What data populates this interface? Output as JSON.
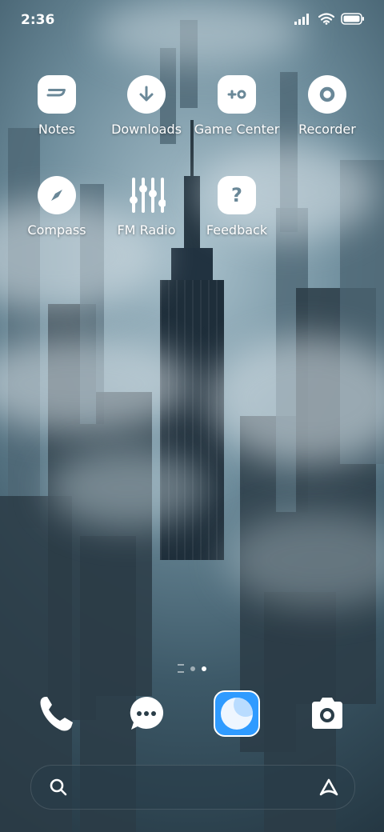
{
  "status_bar": {
    "time": "2:36"
  },
  "home_apps": [
    {
      "label": "Notes",
      "icon": "notes-icon"
    },
    {
      "label": "Downloads",
      "icon": "download-icon"
    },
    {
      "label": "Game Center",
      "icon": "gamepad-icon"
    },
    {
      "label": "Recorder",
      "icon": "record-icon"
    },
    {
      "label": "Compass",
      "icon": "compass-icon"
    },
    {
      "label": "FM Radio",
      "icon": "equalizer-icon"
    },
    {
      "label": "Feedback",
      "icon": "question-icon"
    }
  ],
  "page_indicator": {
    "pages": 2,
    "current": 2
  },
  "dock": [
    {
      "icon": "phone-icon"
    },
    {
      "icon": "messages-icon"
    },
    {
      "icon": "browser-icon"
    },
    {
      "icon": "camera-icon"
    }
  ],
  "colors": {
    "browser_blue": "#2f9bff",
    "icon_white": "#ffffff"
  }
}
